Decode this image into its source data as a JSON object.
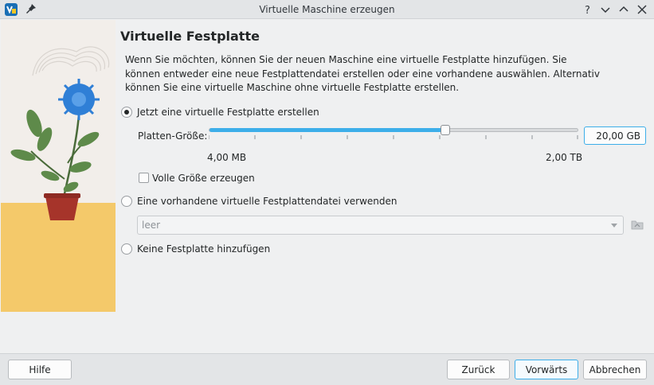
{
  "window": {
    "title": "Virtuelle Maschine erzeugen",
    "app_icon": "virtualbox-icon",
    "controls": [
      "pin-icon",
      "help-icon",
      "minimize-icon",
      "maximize-icon"
    ]
  },
  "page": {
    "heading": "Virtuelle Festplatte",
    "description": "Wenn Sie möchten, können Sie der neuen Maschine eine virtuelle Festplatte hinzufügen. Sie können entweder eine neue Festplattendatei erstellen oder eine vorhandene auswählen. Alternativ können Sie eine virtuelle Maschine ohne virtuelle Festplatte erstellen."
  },
  "options": {
    "create_new": {
      "label": "Jetzt eine virtuelle Festplatte erstellen",
      "checked": true
    },
    "use_existing": {
      "label": "Eine vorhandene virtuelle Festplattendatei verwenden",
      "checked": false
    },
    "no_disk": {
      "label": "Keine Festplatte hinzufügen",
      "checked": false
    }
  },
  "disk_size": {
    "label": "Platten-Größe:",
    "value": "20,00 GB",
    "min_label": "4,00 MB",
    "max_label": "2,00 TB",
    "slider_fraction": 0.64
  },
  "full_size": {
    "label": "Volle Größe erzeugen",
    "checked": false
  },
  "existing_file": {
    "value": "leer",
    "button_icon": "folder-icon"
  },
  "buttons": {
    "help": "Hilfe",
    "back": "Zurück",
    "next": "Vorwärts",
    "cancel": "Abbrechen"
  },
  "colors": {
    "accent": "#3daee9"
  }
}
